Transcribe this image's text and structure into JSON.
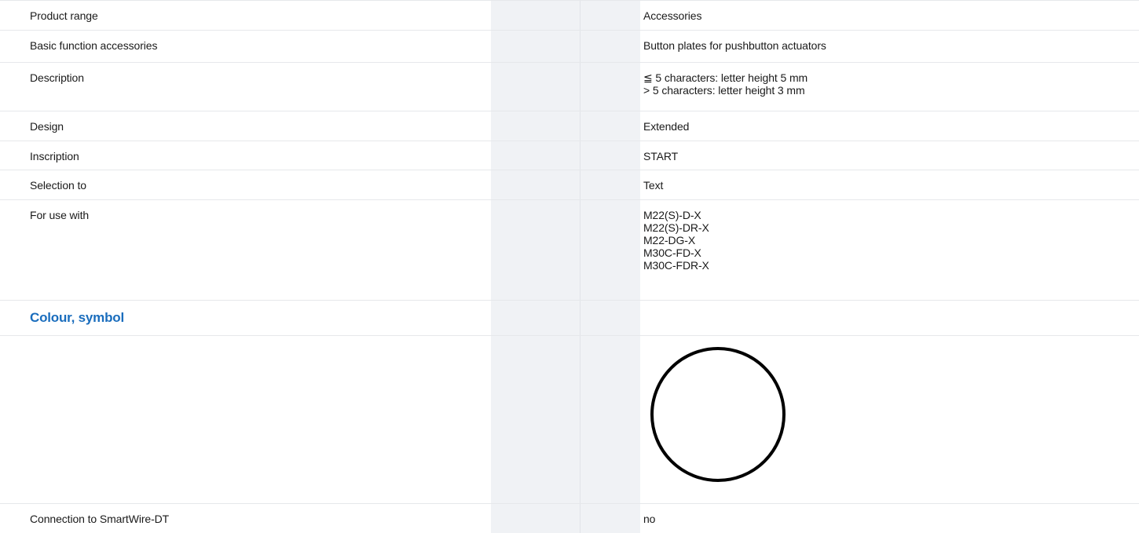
{
  "rows": [
    {
      "label": "Product range",
      "values": [
        "Accessories"
      ]
    },
    {
      "label": "Basic function accessories",
      "values": [
        "Button plates for pushbutton actuators"
      ]
    },
    {
      "label": "Description",
      "values": [
        "≦ 5 characters: letter height 5 mm",
        "> 5 characters: letter height 3 mm"
      ]
    },
    {
      "label": "Design",
      "values": [
        "Extended"
      ]
    },
    {
      "label": "Inscription",
      "values": [
        "START"
      ]
    },
    {
      "label": "Selection to",
      "values": [
        "Text"
      ]
    },
    {
      "label": "For use with",
      "values": [
        "M22(S)-D-X",
        "M22(S)-DR-X",
        "M22-DG-X",
        "M30C-FD-X",
        "M30C-FDR-X"
      ]
    }
  ],
  "section": {
    "title": "Colour, symbol"
  },
  "symbol": {
    "icon": "circle-outline-icon",
    "stroke_color": "#000000"
  },
  "last_row": {
    "label": "Connection to SmartWire-DT",
    "value": "no"
  },
  "colors": {
    "accent": "#1a6dbd",
    "gutter": "#f0f2f5",
    "border": "#e6e8eb"
  }
}
